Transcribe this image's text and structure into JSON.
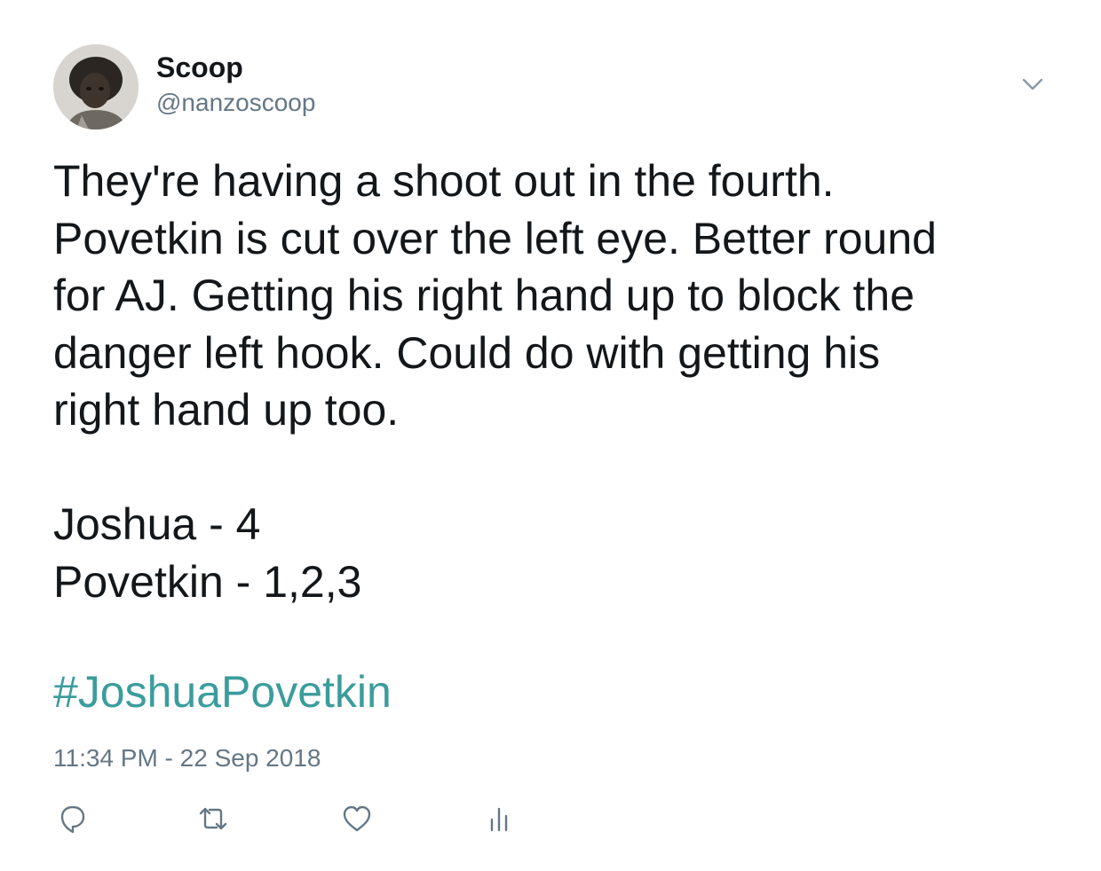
{
  "author": {
    "display_name": "Scoop",
    "handle": "@nanzoscoop"
  },
  "tweet": {
    "lines": [
      "They're having a shoot out in the fourth.",
      "Povetkin is cut over the left eye. Better round",
      "for AJ. Getting his right hand up to block the",
      "danger left hook. Could do with getting his",
      "right hand up too.",
      "",
      "Joshua - 4",
      "Povetkin - 1,2,3"
    ],
    "hashtag": "#JoshuaPovetkin",
    "timestamp": "11:34 PM - 22 Sep 2018"
  },
  "icons": {
    "menu": "chevron-down-icon",
    "reply": "reply-icon",
    "retweet": "retweet-icon",
    "like": "heart-icon",
    "analytics": "analytics-icon"
  },
  "colors": {
    "text": "#14171a",
    "secondary": "#657786",
    "hashtag": "#3a9d9c",
    "icon": "#657786"
  }
}
